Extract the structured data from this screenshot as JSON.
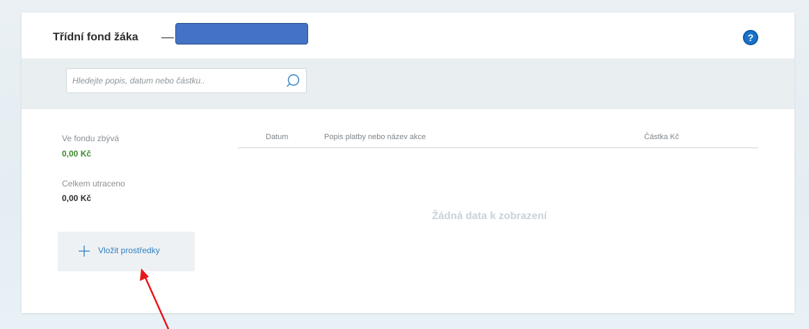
{
  "header": {
    "title": "Třídní fond žáka",
    "dash": "—",
    "help_icon": "question-circle-icon",
    "help_glyph": "?"
  },
  "search": {
    "placeholder": "Hledejte popis, datum nebo částku..",
    "value": "",
    "icon": "search-icon"
  },
  "summary": {
    "remaining_label": "Ve fondu zbývá",
    "remaining_value": "0,00 Kč",
    "remaining_color": "#3a8a2c",
    "spent_label": "Celkem utraceno",
    "spent_value": "0,00 Kč",
    "spent_color": "#2d2d2d"
  },
  "actions": {
    "add_funds_label": "Vložit prostředky",
    "add_funds_icon": "plus-icon"
  },
  "table": {
    "columns": [
      "Datum",
      "Popis platby nebo název akce",
      "Částka Kč"
    ],
    "rows": [],
    "empty_message": "Žádná data k zobrazení"
  },
  "colors": {
    "accent": "#2e7fc2",
    "help_icon": "#1a73c9",
    "redacted_block": "#4472c4",
    "annotation_arrow": "#e8161b"
  }
}
